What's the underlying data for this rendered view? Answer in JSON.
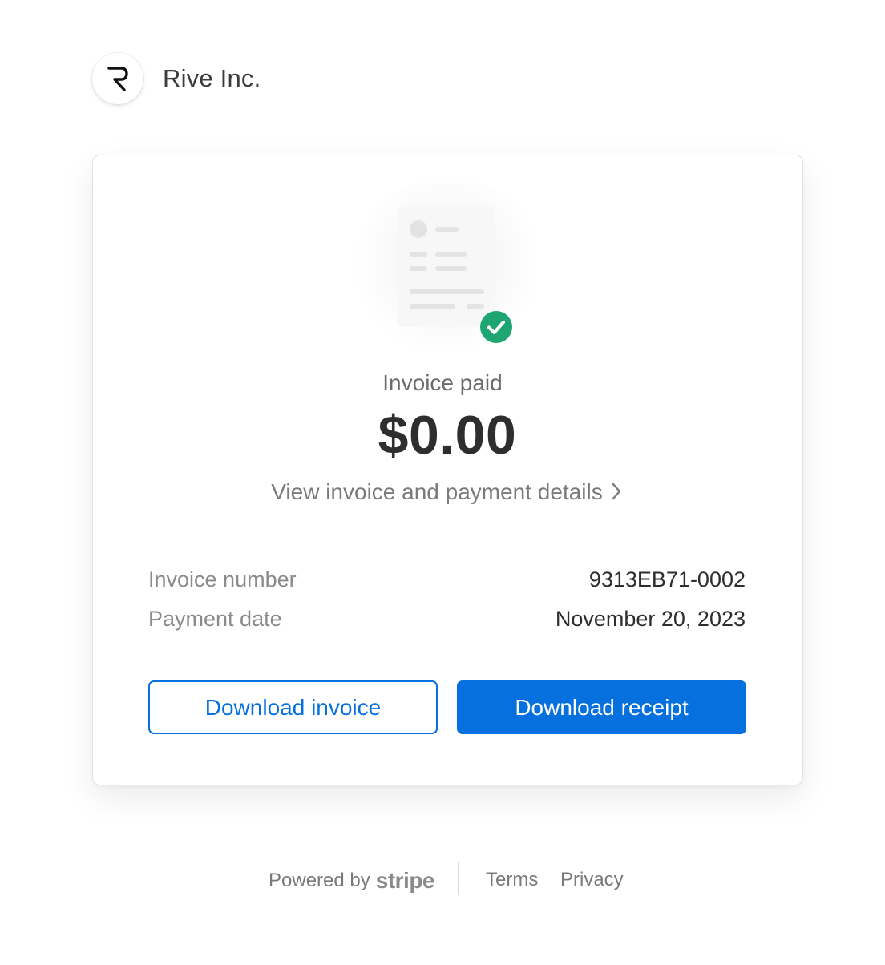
{
  "merchant": {
    "name": "Rive Inc.",
    "logo_icon": "rive-r-logo-icon"
  },
  "invoice": {
    "status_title": "Invoice paid",
    "amount": "$0.00",
    "details_link": "View invoice and payment details",
    "illustration_icon": "invoice-document-icon",
    "status_icon": "check-circle-icon",
    "fields": [
      {
        "label": "Invoice number",
        "value": "9313EB71-0002"
      },
      {
        "label": "Payment date",
        "value": "November 20, 2023"
      }
    ]
  },
  "actions": {
    "download_invoice": "Download invoice",
    "download_receipt": "Download receipt"
  },
  "footer": {
    "powered_by": "Powered by",
    "brand": "stripe",
    "terms": "Terms",
    "privacy": "Privacy"
  },
  "colors": {
    "accent": "#0570de",
    "success": "#1ea672",
    "text_primary": "#2e2e2e",
    "text_muted": "#8a8a8a"
  }
}
